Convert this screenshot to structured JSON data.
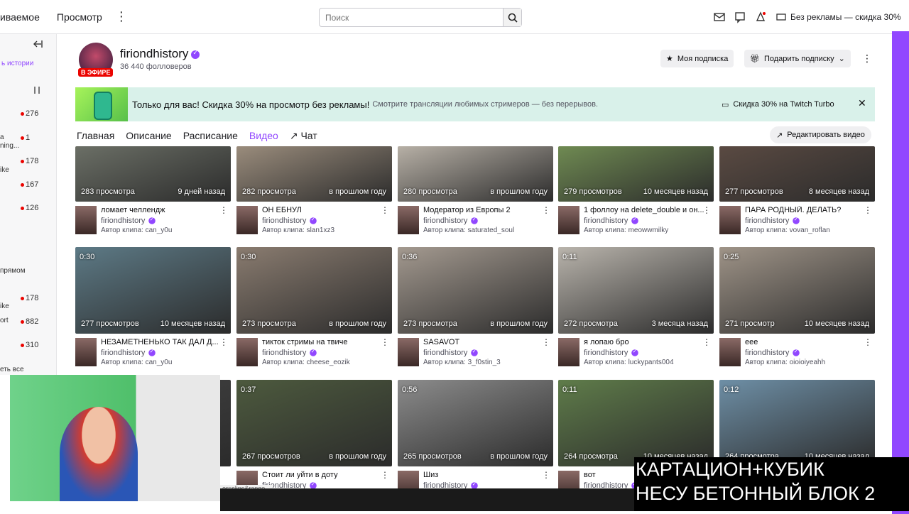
{
  "topbar": {
    "nav": [
      "иваемое",
      "Просмотр"
    ],
    "search_placeholder": "Поиск",
    "promo": "Без рекламы — скидка 30%"
  },
  "sidebar": {
    "label_top": "ь истории",
    "counts": [
      "276",
      "1",
      "178",
      "167",
      "126",
      "178",
      "882",
      "310"
    ],
    "fragments": [
      "а",
      "ning...",
      "ike",
      "ike",
      "ike",
      "ort"
    ],
    "section_live": "прямом",
    "show_all": "еть все"
  },
  "channel": {
    "name": "firiondhistory",
    "followers": "36 440 фолловеров",
    "live_badge": "В ЭФИРЕ",
    "follow_label": "Моя подписка",
    "gift_label": "Подарить подписку"
  },
  "banner": {
    "text": "Только для вас! Скидка 30% на просмотр без рекламы!",
    "sub": "Смотрите трансляции любимых стримеров — без перерывов.",
    "cta": "Скидка 30% на Twitch Turbo"
  },
  "tabs": [
    "Главная",
    "Описание",
    "Расписание",
    "Видео",
    "Чат"
  ],
  "edit_videos": "Редактировать видео",
  "clips": [
    {
      "dur": "",
      "views": "283 просмотра",
      "ago": "9 дней назад",
      "title": "ломает челлендж",
      "channel": "firiondhistory",
      "author": "Автор клипа: can_y0u",
      "color": "#6b6f66"
    },
    {
      "dur": "",
      "views": "282 просмотра",
      "ago": "в прошлом году",
      "title": "ОН ЕБНУЛ",
      "channel": "firiondhistory",
      "author": "Автор клипа: slan1xz3",
      "color": "#9a8c7c"
    },
    {
      "dur": "",
      "views": "280 просмотра",
      "ago": "в прошлом году",
      "title": "Модератор из Европы 2",
      "channel": "firiondhistory",
      "author": "Автор клипа: saturated_soul",
      "color": "#b7b0a6"
    },
    {
      "dur": "",
      "views": "279 просмотров",
      "ago": "10 месяцев назад",
      "title": "1 фоллоу на delete_double и он...",
      "channel": "firiondhistory",
      "author": "Автор клипа: meowwmilky",
      "color": "#6f8a52"
    },
    {
      "dur": "",
      "views": "277 просмотров",
      "ago": "8 месяцев назад",
      "title": "ПАРА РОДНЫЙ. ДЕЛАТЬ?",
      "channel": "firiondhistory",
      "author": "Автор клипа: vovan_roflan",
      "color": "#5a4a42"
    },
    {
      "dur": "0:30",
      "views": "277 просмотров",
      "ago": "10 месяцев назад",
      "title": "НЕЗАМЕТНЕНЬКО ТАК ДАЛ Д...",
      "channel": "firiondhistory",
      "author": "Автор клипа: can_y0u",
      "color": "#5d7a86"
    },
    {
      "dur": "0:30",
      "views": "273 просмотра",
      "ago": "в прошлом году",
      "title": "тикток стримы на твиче",
      "channel": "firiondhistory",
      "author": "Автор клипа: cheese_eozik",
      "color": "#8a7c70"
    },
    {
      "dur": "0:36",
      "views": "273 просмотра",
      "ago": "в прошлом году",
      "title": "SASAVOT",
      "channel": "firiondhistory",
      "author": "Автор клипа: 3_f0stin_3",
      "color": "#a49a90"
    },
    {
      "dur": "0:11",
      "views": "272 просмотра",
      "ago": "3 месяца назад",
      "title": "я лопаю бро",
      "channel": "firiondhistory",
      "author": "Автор клипа: luckypants004",
      "color": "#b9b4ac"
    },
    {
      "dur": "0:25",
      "views": "271 просмотр",
      "ago": "10 месяцев назад",
      "title": "еее",
      "channel": "firiondhistory",
      "author": "Автор клипа: oioioiyeahh",
      "color": "#9f9488"
    },
    {
      "dur": "",
      "views": "",
      "ago": "",
      "title": "",
      "channel": "",
      "author": "",
      "color": "#444"
    },
    {
      "dur": "0:37",
      "views": "267 просмотров",
      "ago": "в прошлом году",
      "title": "Стоит ли уйти в доту",
      "channel": "firiondhistory",
      "author": "",
      "color": "#4d5a3e"
    },
    {
      "dur": "0:56",
      "views": "265 просмотров",
      "ago": "в прошлом году",
      "title": "Шиз",
      "channel": "firiondhistory",
      "author": "",
      "color": "#8c8c8c"
    },
    {
      "dur": "0:11",
      "views": "264 просмотра",
      "ago": "10 месяцев назад",
      "title": "вот",
      "channel": "firiondhistory",
      "author": "",
      "color": "#5f7c4a"
    },
    {
      "dur": "0:12",
      "views": "264 просмотра",
      "ago": "10 месяцев назад",
      "title": "",
      "channel": "",
      "author": "",
      "color": "#6e8fa6"
    }
  ],
  "overlay": {
    "line1": "КАРТАЦИОН+КУБИК",
    "line2": "НЕСУ БЕТОННЫЙ БЛОК 2"
  },
  "url_hint": "er=clips&range..."
}
